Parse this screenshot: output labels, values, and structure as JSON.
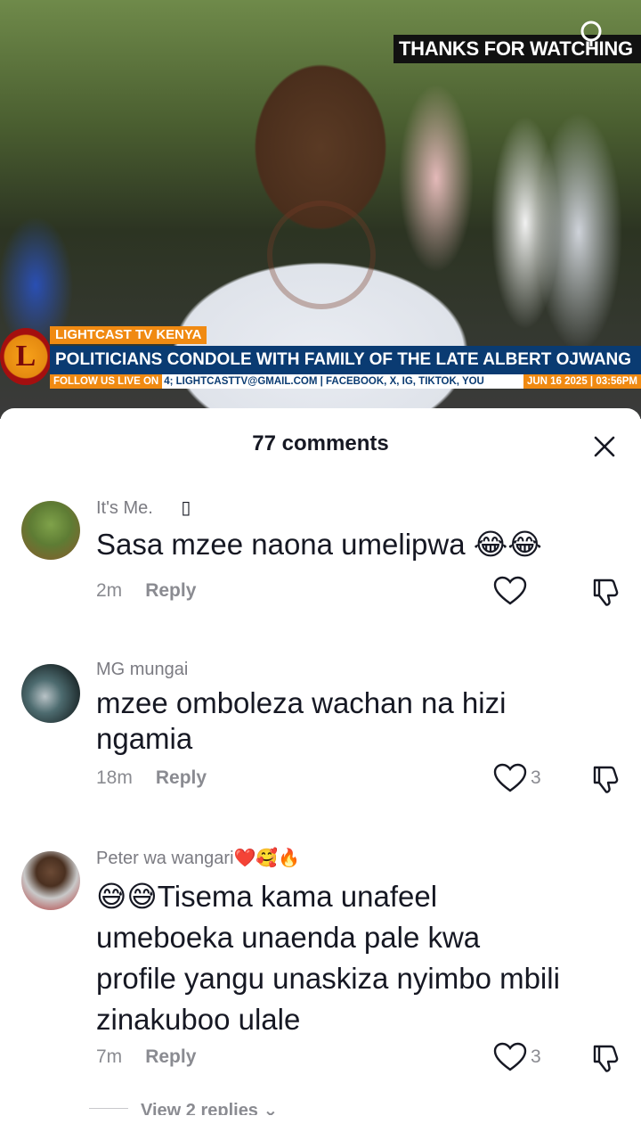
{
  "video": {
    "overlay_text": "THANKS FOR WATCHING",
    "lower_third": {
      "logo_letter": "L",
      "tag": "LIGHTCAST TV KENYA",
      "headline": "POLITICIANS CONDOLE WITH FAMILY OF THE LATE ALBERT OJWANG",
      "follow_label": "FOLLOW US LIVE ON",
      "links": "4; LIGHTCASTTV@GMAIL.COM | FACEBOOK, X, IG, TIKTOK, YOU",
      "date": "JUN 16 2025 | 03:56PM"
    }
  },
  "sheet": {
    "title": "77 comments",
    "close_icon": "close-icon"
  },
  "comments": [
    {
      "username": "It's Me.",
      "badge": "▯",
      "text": "Sasa mzee naona umelipwa 😂😂",
      "time": "2m",
      "reply_label": "Reply",
      "likes": ""
    },
    {
      "username": "MG mungai",
      "text": "mzee omboleza wachan na hizi ngamia",
      "time": "18m",
      "reply_label": "Reply",
      "likes": "3"
    },
    {
      "username": "Peter wa wangari❤️🥰🔥",
      "text": "😅😅Tisema kama unafeel umeboeka unaenda pale kwa profile yangu unaskiza nyimbo mbili zinakuboo ulale",
      "time": "7m",
      "reply_label": "Reply",
      "likes": "3"
    }
  ],
  "view_replies": "View 2 replies ⌄",
  "colors": {
    "headline_bg": "#0a3b72",
    "accent_orange": "#f08a12",
    "meta_gray": "#8a8b91"
  }
}
